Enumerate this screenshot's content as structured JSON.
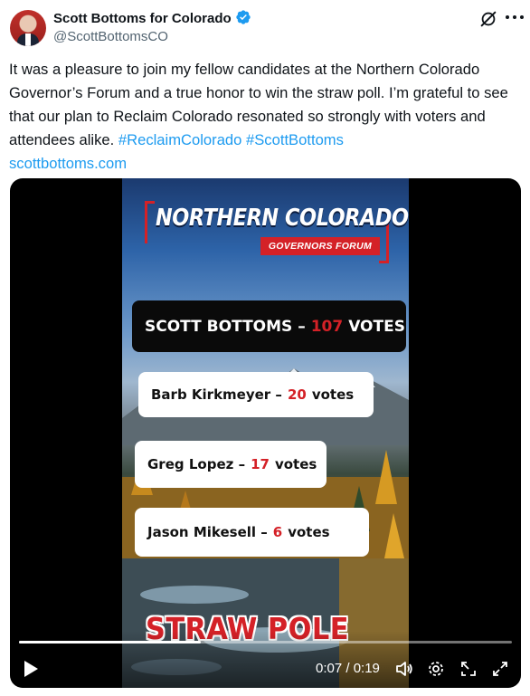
{
  "author": {
    "name": "Scott Bottoms for Colorado",
    "handle": "@ScottBottomsCO"
  },
  "tweet": {
    "text": "It was a pleasure to join my fellow candidates at the Northern Colorado Governor’s Forum and a true honor to win the straw poll. I’m grateful to see that our plan to Reclaim Colorado resonated so strongly with voters and attendees alike.",
    "hashtag1": "#ReclaimColorado",
    "hashtag2": "#ScottBottoms",
    "link": "scottbottoms.com"
  },
  "video": {
    "logo_title": "NORTHERN COLORADO",
    "logo_subtitle": "GOVERNORS FORUM",
    "results": [
      {
        "name": "SCOTT BOTTOMS –",
        "votes": "107",
        "unit": "VOTES"
      },
      {
        "name": "Barb Kirkmeyer –",
        "votes": "20",
        "unit": "votes"
      },
      {
        "name": "Greg Lopez –",
        "votes": "17",
        "unit": "votes"
      },
      {
        "name": "Jason Mikesell –",
        "votes": "6",
        "unit": "votes"
      }
    ],
    "banner": "STRAW POLE",
    "time_display": "0:07 / 0:19",
    "progress": 0.368
  },
  "icons": [
    "verified-badge-icon",
    "grok-icon",
    "more-icon",
    "play-icon",
    "volume-icon",
    "settings-icon",
    "pip-icon",
    "fullscreen-icon"
  ],
  "colors": {
    "accent": "#1d9bf0",
    "brand_red": "#d42127"
  }
}
